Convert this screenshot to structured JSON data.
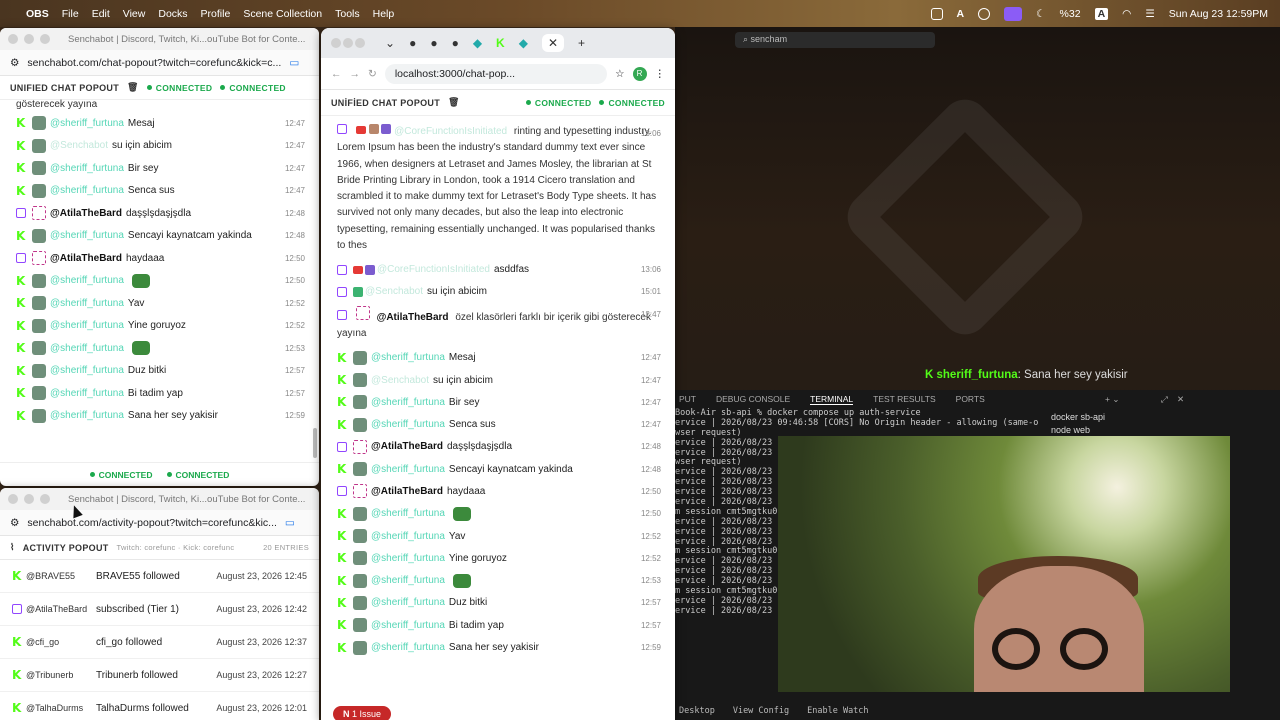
{
  "menubar": {
    "app": "OBS",
    "items": [
      "File",
      "Edit",
      "View",
      "Docks",
      "Profile",
      "Scene Collection",
      "Tools",
      "Help"
    ],
    "battery": "%32",
    "input_source": "A",
    "datetime": "Sun Aug 23  12:59PM"
  },
  "chat_window": {
    "title": "Senchabot | Discord, Twitch, Ki...ouTube Bot for Conte...",
    "url": "senchabot.com/chat-popout?twitch=corefunc&kick=c...",
    "header": "UNIFIED CHAT POPOUT",
    "status_a": "CONNECTED",
    "status_b": "CONNECTED",
    "partial_line": "gösterecek yayına",
    "footer_a": "CONNECTED",
    "footer_b": "CONNECTED",
    "rows": [
      {
        "p": "k",
        "user": "@sheriff_furtuna",
        "msg": "Mesaj",
        "time": "12:47"
      },
      {
        "p": "k",
        "user": "@Senchabot",
        "msg": "su için abicim",
        "time": "12:47",
        "dim": true
      },
      {
        "p": "k",
        "user": "@sheriff_furtuna",
        "msg": "Bir sey",
        "time": "12:47"
      },
      {
        "p": "k",
        "user": "@sheriff_furtuna",
        "msg": "Senca sus",
        "time": "12:47"
      },
      {
        "p": "t",
        "user": "@AtilaTheBard",
        "msg": "daşşlşdaşjşdla",
        "time": "12:48"
      },
      {
        "p": "k",
        "user": "@sheriff_furtuna",
        "msg": "Sencayi kaynatcam yakinda",
        "time": "12:48"
      },
      {
        "p": "t",
        "user": "@AtilaTheBard",
        "msg": "haydaaa",
        "time": "12:50"
      },
      {
        "p": "k",
        "user": "@sheriff_furtuna",
        "msg": "",
        "time": "12:50",
        "emote": true
      },
      {
        "p": "k",
        "user": "@sheriff_furtuna",
        "msg": "Yav",
        "time": "12:52"
      },
      {
        "p": "k",
        "user": "@sheriff_furtuna",
        "msg": "Yine goruyoz",
        "time": "12:52"
      },
      {
        "p": "k",
        "user": "@sheriff_furtuna",
        "msg": "",
        "time": "12:53",
        "emote": true
      },
      {
        "p": "k",
        "user": "@sheriff_furtuna",
        "msg": "Duz bitki",
        "time": "12:57"
      },
      {
        "p": "k",
        "user": "@sheriff_furtuna",
        "msg": "Bi tadim yap",
        "time": "12:57"
      },
      {
        "p": "k",
        "user": "@sheriff_furtuna",
        "msg": "Sana her sey yakisir",
        "time": "12:59"
      }
    ]
  },
  "activity_window": {
    "title": "Senchabot | Discord, Twitch, Ki...ouTube Bot for Conte...",
    "url": "senchabot.com/activity-popout?twitch=corefunc&kic...",
    "header": "ACTIVITY POPOUT",
    "sub": "Twitch: corefunc · Kick: corefunc",
    "entries_count": "20 ENTRIES",
    "rows": [
      {
        "p": "k",
        "who": "@BRAVE55",
        "what": "BRAVE55 followed",
        "when": "August 23, 2026 12:45"
      },
      {
        "p": "t",
        "who": "@AtilaTheBard",
        "what": "subscribed (Tier 1)",
        "when": "August 23, 2026 12:42"
      },
      {
        "p": "k",
        "who": "@cfi_go",
        "what": "cfi_go followed",
        "when": "August 23, 2026 12:37"
      },
      {
        "p": "k",
        "who": "@Tribunerb",
        "what": "Tribunerb followed",
        "when": "August 23, 2026 12:27"
      },
      {
        "p": "k",
        "who": "@TalhaDurms",
        "what": "TalhaDurms followed",
        "when": "August 23, 2026 12:01"
      }
    ]
  },
  "mid_window": {
    "url": "localhost:3000/chat-pop...",
    "profile_letter": "R",
    "header": "UNİFİED CHAT POPOUT",
    "status_a": "CONNECTED",
    "status_b": "CONNECTED",
    "long_user": "@CoreFunctionIsInitiated",
    "long_msg": "rinting and typesetting industry. Lorem Ipsum has been the industry's standard dummy text ever since 1966, when designers at Letraset and James Mosley, the librarian at St Bride Printing Library in London, took a 1914 Cicero translation and scrambled it to make dummy text for Letraset's Body Type sheets. It has survived not only many decades, but also the leap into electronic typesetting, remaining essentially unchanged. It was popularised thanks to thes",
    "long_time": "13:06",
    "asd_user": "@CoreFunctionIsInitiated",
    "asd_msg": "asddfas",
    "asd_time": "13:06",
    "sench_user": "@Senchabot",
    "sench_msg": "su için abicim",
    "sench_time": "15:01",
    "atila_user": "@AtilaTheBard",
    "atila_msg": "özel klasörleri farklı bir içerik gibi gösterecek yayına",
    "atila_time": "12:47",
    "rows": [
      {
        "p": "k",
        "user": "@sheriff_furtuna",
        "msg": "Mesaj",
        "time": "12:47"
      },
      {
        "p": "k",
        "user": "@Senchabot",
        "msg": "su için abicim",
        "time": "12:47",
        "dim": true
      },
      {
        "p": "k",
        "user": "@sheriff_furtuna",
        "msg": "Bir sey",
        "time": "12:47"
      },
      {
        "p": "k",
        "user": "@sheriff_furtuna",
        "msg": "Senca sus",
        "time": "12:47"
      },
      {
        "p": "t",
        "user": "@AtilaTheBard",
        "msg": "daşşlşdaşjşdla",
        "time": "12:48"
      },
      {
        "p": "k",
        "user": "@sheriff_furtuna",
        "msg": "Sencayi kaynatcam yakinda",
        "time": "12:48"
      },
      {
        "p": "t",
        "user": "@AtilaTheBard",
        "msg": "haydaaa",
        "time": "12:50"
      },
      {
        "p": "k",
        "user": "@sheriff_furtuna",
        "msg": "",
        "time": "12:50",
        "emote": true
      },
      {
        "p": "k",
        "user": "@sheriff_furtuna",
        "msg": "Yav",
        "time": "12:52"
      },
      {
        "p": "k",
        "user": "@sheriff_furtuna",
        "msg": "Yine goruyoz",
        "time": "12:52"
      },
      {
        "p": "k",
        "user": "@sheriff_furtuna",
        "msg": "",
        "time": "12:53",
        "emote": true
      },
      {
        "p": "k",
        "user": "@sheriff_furtuna",
        "msg": "Duz bitki",
        "time": "12:57"
      },
      {
        "p": "k",
        "user": "@sheriff_furtuna",
        "msg": "Bi tadim yap",
        "time": "12:57"
      },
      {
        "p": "k",
        "user": "@sheriff_furtuna",
        "msg": "Sana her sey yakisir",
        "time": "12:59"
      }
    ],
    "issue_badge": "1 Issue"
  },
  "editor": {
    "search": "sencham",
    "overlay_user": "sheriff_furtuna",
    "overlay_msg": ": Sana her sey yakisir"
  },
  "terminal": {
    "tabs": [
      "PUT",
      "DEBUG CONSOLE",
      "TERMINAL",
      "TEST RESULTS",
      "PORTS"
    ],
    "prompt": "Book-Air sb-api % docker compose up auth-service",
    "lines": [
      "ervice  | 2026/08/23 09:46:58 [CORS] No Origin header - allowing (same-o",
      "wser request)",
      "ervice  | 2026/08/23",
      "ervice  | 2026/08/23",
      "wser request)",
      "ervice  | 2026/08/23",
      "ervice  | 2026/08/23",
      "ervice  | 2026/08/23",
      "ervice  | 2026/08/23",
      "m session cmt5mgtku0",
      "ervice  | 2026/08/23",
      "ervice  | 2026/08/23",
      "ervice  | 2026/08/23",
      "m session cmt5mgtku0",
      "ervice  | 2026/08/23",
      "ervice  | 2026/08/23",
      "ervice  | 2026/08/23",
      "m session cmt5mgtku0",
      "ervice  | 2026/08/23",
      "ervice  | 2026/08/23"
    ],
    "side_items": [
      "docker  sb-api",
      "node  web"
    ],
    "status": [
      "Desktop",
      "View Config",
      "Enable Watch"
    ]
  }
}
